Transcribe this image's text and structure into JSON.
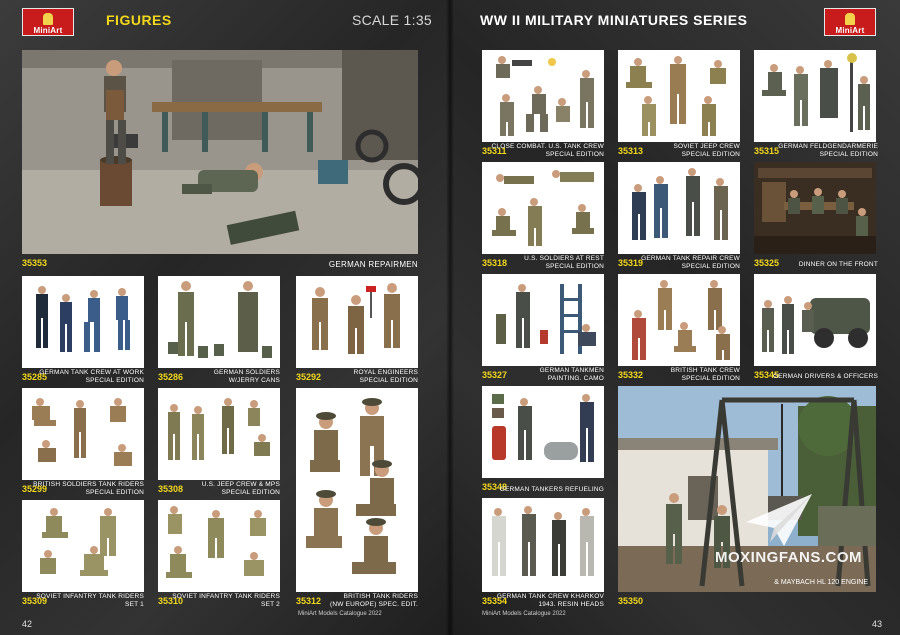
{
  "left_page": {
    "brand": "MiniArt",
    "section_title": "FIGURES",
    "scale": "SCALE 1:35",
    "page_number": "42",
    "catalog_note": "MiniArt Models Catalogue 2022",
    "hero": {
      "code": "35353",
      "caption": "GERMAN REPAIRMEN"
    },
    "products": [
      {
        "code": "35285",
        "title": "GERMAN TANK CREW AT WORK",
        "sub": "SPECIAL EDITION"
      },
      {
        "code": "35286",
        "title": "GERMAN SOLDIERS",
        "sub": "W/JERRY CANS"
      },
      {
        "code": "35292",
        "title": "ROYAL ENGINEERS",
        "sub": "SPECIAL EDITION"
      },
      {
        "code": "35299",
        "title": "BRITISH SOLDIERS TANK RIDERS",
        "sub": "SPECIAL EDITION"
      },
      {
        "code": "35308",
        "title": "U.S. JEEP CREW & MPS",
        "sub": "SPECIAL EDITION"
      },
      {
        "code": "35309",
        "title": "SOVIET INFANTRY TANK RIDERS",
        "sub": "SET 1"
      },
      {
        "code": "35310",
        "title": "SOVIET INFANTRY TANK RIDERS",
        "sub": "SET 2"
      },
      {
        "code": "35312",
        "title": "BRITISH TANK RIDERS",
        "sub": "(NW EUROPE) SPEC. EDIT."
      }
    ]
  },
  "right_page": {
    "series_title": "WW II MILITARY MINIATURES SERIES",
    "brand": "MiniArt",
    "page_number": "43",
    "catalog_note": "MiniArt Models Catalogue 2022",
    "products": [
      {
        "code": "35311",
        "title": "CLOSE COMBAT. U.S. TANK CREW",
        "sub": "SPECIAL EDITION"
      },
      {
        "code": "35313",
        "title": "SOVIET JEEP CREW",
        "sub": "SPECIAL EDITION"
      },
      {
        "code": "35315",
        "title": "GERMAN FELDGENDARMERIE",
        "sub": "SPECIAL EDITION"
      },
      {
        "code": "35318",
        "title": "U.S. SOLDIERS AT REST",
        "sub": "SPECIAL EDITION"
      },
      {
        "code": "35319",
        "title": "GERMAN TANK REPAIR CREW",
        "sub": "SPECIAL EDITION"
      },
      {
        "code": "35325",
        "title": "DINNER ON THE FRONT",
        "sub": ""
      },
      {
        "code": "35327",
        "title": "GERMAN TANKMEN",
        "sub": "PAINTING. CAMO"
      },
      {
        "code": "35332",
        "title": "BRITISH TANK CREW",
        "sub": "SPECIAL EDITION"
      },
      {
        "code": "35345",
        "title": "GERMAN DRIVERS & OFFICERS",
        "sub": ""
      },
      {
        "code": "35348",
        "title": "GERMAN TANKERS REFUELING",
        "sub": ""
      },
      {
        "code": "35354",
        "title": "GERMAN TANK CREW KHARKOV",
        "sub": "1943. RESIN HEADS"
      },
      {
        "code": "35350",
        "title": "",
        "sub": ""
      }
    ],
    "watermark": "MOXINGFANS.COM",
    "watermark_sub": "& MAYBACH HL 120 ENGINE"
  },
  "colors": {
    "code_yellow": "#f2d81d",
    "logo_red": "#c81b1b",
    "page_bg": "#2b2b2b"
  }
}
